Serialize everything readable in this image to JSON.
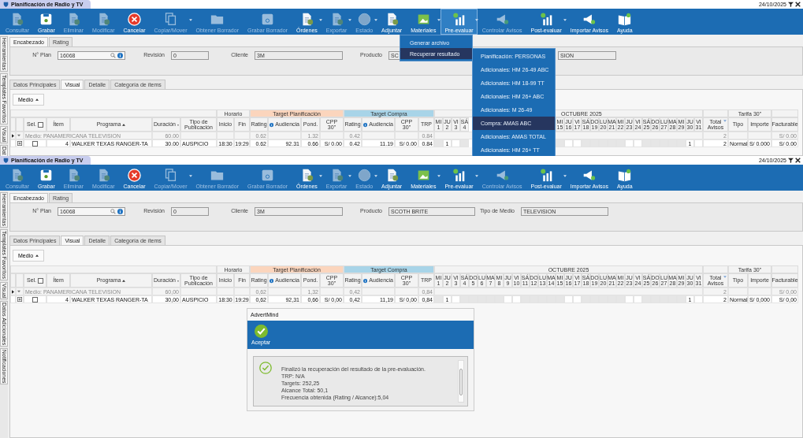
{
  "windows": [
    {
      "title": "Planificación de Radio y TV",
      "date": "24/10/2025",
      "toolbar": [
        {
          "label": "Consultar",
          "kind": "doc",
          "disabled": true,
          "dropdown": false,
          "open": false
        },
        {
          "label": "Grabar",
          "kind": "save",
          "disabled": false,
          "dropdown": false,
          "open": false
        },
        {
          "label": "Eliminar",
          "kind": "doc",
          "disabled": true,
          "dropdown": false,
          "open": false
        },
        {
          "label": "Modificar",
          "kind": "doc",
          "disabled": true,
          "dropdown": false,
          "open": false
        },
        {
          "label": "Cancelar",
          "kind": "cancel",
          "disabled": false,
          "dropdown": false,
          "open": false
        },
        {
          "label": "Copiar/Mover",
          "kind": "copy",
          "disabled": true,
          "dropdown": true,
          "open": false
        },
        {
          "label": "Obtener Borrador",
          "kind": "folder",
          "disabled": true,
          "dropdown": false,
          "open": false
        },
        {
          "label": "Grabar Borrador",
          "kind": "disk",
          "disabled": true,
          "dropdown": false,
          "open": false
        },
        {
          "label": "Órdenes",
          "kind": "doc",
          "disabled": false,
          "dropdown": true,
          "open": false
        },
        {
          "label": "Exportar",
          "kind": "doc",
          "disabled": true,
          "dropdown": true,
          "open": false
        },
        {
          "label": "Estado",
          "kind": "globe",
          "disabled": true,
          "dropdown": true,
          "open": false
        },
        {
          "label": "Adjuntar",
          "kind": "doc",
          "disabled": false,
          "dropdown": false,
          "open": false
        },
        {
          "label": "Materiales",
          "kind": "image",
          "disabled": false,
          "dropdown": true,
          "open": false
        },
        {
          "label": "Pre-evaluar",
          "kind": "chart",
          "disabled": false,
          "dropdown": true,
          "open": true
        },
        {
          "label": "Controlar Avisos",
          "kind": "megaphone",
          "disabled": true,
          "dropdown": false,
          "open": false
        },
        {
          "label": "Post-evaluar",
          "kind": "chart",
          "disabled": false,
          "dropdown": true,
          "open": false
        },
        {
          "label": "Importar Avisos",
          "kind": "megaphone",
          "disabled": false,
          "dropdown": false,
          "open": false
        },
        {
          "label": "Ayuda",
          "kind": "book",
          "disabled": false,
          "dropdown": false,
          "open": false
        }
      ],
      "side_tabs": [
        "Herramientas",
        "Templates Favoritos",
        "Visual",
        "Dat"
      ],
      "header_tabs": [
        {
          "label": "Encabezado",
          "selected": true
        },
        {
          "label": "Rating",
          "selected": false
        }
      ],
      "fields": [
        {
          "label": "N° Plan",
          "value": "16068",
          "kind": "search"
        },
        {
          "label": "Revisión",
          "value": "0",
          "kind": "text"
        },
        {
          "label": "Cliente",
          "value": "3M",
          "kind": "text"
        },
        {
          "label": "Producto",
          "value": "SC",
          "kind": "text"
        },
        {
          "value": "SION",
          "kind": "text"
        }
      ],
      "tabs": [
        {
          "label": "Datos Principales",
          "selected": false
        },
        {
          "label": "Visual",
          "selected": true
        },
        {
          "label": "Detalle",
          "selected": false
        },
        {
          "label": "Categoría de ítems",
          "selected": false
        }
      ],
      "group_by": "Medio",
      "grid": {
        "groups": [
          {
            "columns": [
              {
                "kind": "blank"
              },
              {
                "kind": "blank"
              },
              {
                "label": "Sel.",
                "kind": "check",
                "checked": false
              },
              {
                "label": "Ítem",
                "kind": "plain"
              },
              {
                "label": "Programa",
                "kind": "sort"
              },
              {
                "label": "Duración",
                "kind": "sort"
              },
              {
                "label": "Tipo de Publicación",
                "kind": "plain"
              }
            ]
          },
          {
            "label": "Horario",
            "columns": [
              {
                "label": "Inicio",
                "kind": "plain"
              },
              {
                "label": "Fin",
                "kind": "plain"
              }
            ]
          },
          {
            "label": "Target Planificación",
            "color": "#fbd5bd",
            "columns": [
              {
                "label": "Rating",
                "kind": "plain"
              },
              {
                "label": "Audiencia",
                "kind": "info"
              },
              {
                "label": "Pond.",
                "kind": "plain"
              },
              {
                "label": "CPP 30\"",
                "kind": "plain"
              }
            ]
          },
          {
            "label": "Target Compra",
            "color": "#a8d4e8",
            "columns": [
              {
                "label": "Rating",
                "kind": "plain"
              },
              {
                "label": "Audiencia",
                "kind": "info"
              },
              {
                "label": "CPP 30\"",
                "kind": "plain"
              },
              {
                "label": "TRP",
                "kind": "plain"
              }
            ]
          },
          {
            "label": "OCTUBRE 2025",
            "kind": "days"
          },
          {
            "columns": [
              {
                "label": "Total Avisos",
                "kind": "filter"
              }
            ]
          },
          {
            "label": "Tarifa 30\"",
            "columns": [
              {
                "label": "Tipo",
                "kind": "plain"
              },
              {
                "label": "Importe",
                "kind": "plain"
              }
            ]
          },
          {
            "columns": [
              {
                "label": "Facturable",
                "kind": "plain"
              }
            ]
          }
        ],
        "day_segments": [
          [
            {
              "weekday": "MI",
              "day": "1"
            },
            {
              "weekday": "JU",
              "day": "2"
            },
            {
              "weekday": "VI",
              "day": "3"
            },
            {
              "weekday": "SÁ",
              "day": "4"
            }
          ],
          [
            {
              "weekday": "MI",
              "day": "15"
            },
            {
              "weekday": "JU",
              "day": "16"
            },
            {
              "weekday": "VI",
              "day": "17"
            },
            {
              "weekday": "SÁ",
              "day": "18"
            },
            {
              "weekday": "DO",
              "day": "19"
            },
            {
              "weekday": "LU",
              "day": "20"
            },
            {
              "weekday": "MA",
              "day": "21"
            },
            {
              "weekday": "MI",
              "day": "22"
            },
            {
              "weekday": "JU",
              "day": "23"
            },
            {
              "weekday": "VI",
              "day": "24"
            },
            {
              "weekday": "SÁ",
              "day": "25"
            },
            {
              "weekday": "DO",
              "day": "26"
            },
            {
              "weekday": "LU",
              "day": "27"
            },
            {
              "weekday": "MA",
              "day": "28"
            },
            {
              "weekday": "MI",
              "day": "29"
            },
            {
              "weekday": "JU",
              "day": "30"
            },
            {
              "weekday": "VI",
              "day": "31"
            }
          ]
        ],
        "rows": [
          {
            "kind": "group",
            "expanded": true,
            "label": "Medio: PANAMERICANA TELEVISION",
            "duracion": "60.00",
            "rating_plan": "0.62",
            "pond": "1.32",
            "rating_compra": "0.42",
            "trp": "0.84",
            "total_avisos": "2",
            "facturable": "S/ 0.00"
          },
          {
            "kind": "item",
            "expanded": false,
            "checked": false,
            "item": "4",
            "programa": "WALKER TEXAS RANGER-TA",
            "duracion": "30.00",
            "tipo_publicacion": "AUSPICIO",
            "inicio": "18:30",
            "fin": "19:29",
            "rating_plan": "0.62",
            "audiencia_plan": "92.31",
            "pond": "0.66",
            "cpp_plan": "S/ 0.00",
            "rating_compra": "0.42",
            "audiencia_compra": "11.19",
            "cpp_compra": "S/ 0.00",
            "trp": "0.84",
            "total_avisos": "2",
            "tipo": "Normal",
            "importe": "S/ 0.000",
            "facturable": "S/ 0.00",
            "day_segments": [
              [
                {
                  "available": false
                },
                {
                  "available": true,
                  "spots": "1"
                },
                {
                  "available": true
                },
                {
                  "available": false
                }
              ],
              [
                {
                  "available": false
                },
                {
                  "available": true
                },
                {
                  "available": true
                },
                {
                  "available": false
                },
                {
                  "available": false
                },
                {
                  "available": false
                },
                {
                  "available": false
                },
                {
                  "available": false
                },
                {
                  "available": true
                },
                {
                  "available": true
                },
                {
                  "available": false
                },
                {
                  "available": false
                },
                {
                  "available": false
                },
                {
                  "available": false
                },
                {
                  "available": false
                },
                {
                  "available": true,
                  "spots": "1"
                },
                {
                  "available": true
                }
              ]
            ]
          }
        ]
      },
      "menu": {
        "items": [
          {
            "label": "Generar archivo",
            "selected": false
          },
          {
            "label": "Recuperar resultado",
            "selected": true
          }
        ],
        "submenu": [
          {
            "label": "Planificación: PERSONAS",
            "selected": false
          },
          {
            "label": "Adicionales: HM 26-49 ABC",
            "selected": false
          },
          {
            "label": "Adicionales: HM 18-99 TT",
            "selected": false
          },
          {
            "label": "Adicionales: HM 26+ ABC",
            "selected": false
          },
          {
            "label": "Adicionales: M 26-49",
            "selected": false
          },
          {
            "label": "Compra: AMAS ABC",
            "selected": true
          },
          {
            "label": "Adicionales: AMAS TOTAL",
            "selected": false
          },
          {
            "label": "Adicionales: HM 26+ TT",
            "selected": false
          }
        ]
      }
    },
    {
      "title": "Planificación de Radio y TV",
      "date": "24/10/2025",
      "toolbar": [
        {
          "label": "Consultar",
          "kind": "doc",
          "disabled": true,
          "dropdown": false,
          "open": false
        },
        {
          "label": "Grabar",
          "kind": "save",
          "disabled": false,
          "dropdown": false,
          "open": false
        },
        {
          "label": "Eliminar",
          "kind": "doc",
          "disabled": true,
          "dropdown": false,
          "open": false
        },
        {
          "label": "Modificar",
          "kind": "doc",
          "disabled": true,
          "dropdown": false,
          "open": false
        },
        {
          "label": "Cancelar",
          "kind": "cancel",
          "disabled": false,
          "dropdown": false,
          "open": false
        },
        {
          "label": "Copiar/Mover",
          "kind": "copy",
          "disabled": true,
          "dropdown": true,
          "open": false
        },
        {
          "label": "Obtener Borrador",
          "kind": "folder",
          "disabled": true,
          "dropdown": false,
          "open": false
        },
        {
          "label": "Grabar Borrador",
          "kind": "disk",
          "disabled": true,
          "dropdown": false,
          "open": false
        },
        {
          "label": "Órdenes",
          "kind": "doc",
          "disabled": false,
          "dropdown": true,
          "open": false
        },
        {
          "label": "Exportar",
          "kind": "doc",
          "disabled": true,
          "dropdown": true,
          "open": false
        },
        {
          "label": "Estado",
          "kind": "globe",
          "disabled": true,
          "dropdown": true,
          "open": false
        },
        {
          "label": "Adjuntar",
          "kind": "doc",
          "disabled": false,
          "dropdown": false,
          "open": false
        },
        {
          "label": "Materiales",
          "kind": "image",
          "disabled": false,
          "dropdown": true,
          "open": false
        },
        {
          "label": "Pre-evaluar",
          "kind": "chart",
          "disabled": false,
          "dropdown": true,
          "open": false
        },
        {
          "label": "Controlar Avisos",
          "kind": "megaphone",
          "disabled": true,
          "dropdown": false,
          "open": false
        },
        {
          "label": "Post-evaluar",
          "kind": "chart",
          "disabled": false,
          "dropdown": true,
          "open": false
        },
        {
          "label": "Importar Avisos",
          "kind": "megaphone",
          "disabled": false,
          "dropdown": false,
          "open": false
        },
        {
          "label": "Ayuda",
          "kind": "book",
          "disabled": false,
          "dropdown": false,
          "open": false
        }
      ],
      "side_tabs": [
        "Herramientas",
        "Templates Favoritos",
        "Visual",
        "Datos Adicionales",
        "Notificaciones"
      ],
      "header_tabs": [
        {
          "label": "Encabezado",
          "selected": true
        },
        {
          "label": "Rating",
          "selected": false
        }
      ],
      "fields": [
        {
          "label": "N° Plan",
          "value": "16068",
          "kind": "search"
        },
        {
          "label": "Revisión",
          "value": "0",
          "kind": "text"
        },
        {
          "label": "Cliente",
          "value": "3M",
          "kind": "text"
        },
        {
          "label": "Producto",
          "value": "SCOTH BRITE",
          "kind": "text"
        },
        {
          "label": "Tipo de Medio",
          "value": "TELEVISION",
          "kind": "text"
        }
      ],
      "tabs": [
        {
          "label": "Datos Principales",
          "selected": false
        },
        {
          "label": "Visual",
          "selected": true
        },
        {
          "label": "Detalle",
          "selected": false
        },
        {
          "label": "Categoría de ítems",
          "selected": false
        }
      ],
      "group_by": "Medio",
      "grid": {
        "groups": [
          {
            "columns": [
              {
                "kind": "blank"
              },
              {
                "kind": "blank"
              },
              {
                "label": "Sel.",
                "kind": "check",
                "checked": false
              },
              {
                "label": "Ítem",
                "kind": "plain"
              },
              {
                "label": "Programa",
                "kind": "sort"
              },
              {
                "label": "Duración",
                "kind": "sort"
              },
              {
                "label": "Tipo de Publicación",
                "kind": "plain"
              }
            ]
          },
          {
            "label": "Horario",
            "columns": [
              {
                "label": "Inicio",
                "kind": "plain"
              },
              {
                "label": "Fin",
                "kind": "plain"
              }
            ]
          },
          {
            "label": "Target Planificación",
            "color": "#fbd5bd",
            "columns": [
              {
                "label": "Rating",
                "kind": "plain"
              },
              {
                "label": "Audiencia",
                "kind": "info"
              },
              {
                "label": "Pond.",
                "kind": "plain"
              },
              {
                "label": "CPP 30\"",
                "kind": "plain"
              }
            ]
          },
          {
            "label": "Target Compra",
            "color": "#a8d4e8",
            "columns": [
              {
                "label": "Rating",
                "kind": "plain"
              },
              {
                "label": "Audiencia",
                "kind": "info"
              },
              {
                "label": "CPP 30\"",
                "kind": "plain"
              },
              {
                "label": "TRP",
                "kind": "plain"
              }
            ]
          },
          {
            "label": "OCTUBRE 2025",
            "kind": "days"
          },
          {
            "columns": [
              {
                "label": "Total Avisos",
                "kind": "filter"
              }
            ]
          },
          {
            "label": "Tarifa 30\"",
            "columns": [
              {
                "label": "Tipo",
                "kind": "plain"
              },
              {
                "label": "Importe",
                "kind": "plain"
              }
            ]
          },
          {
            "columns": [
              {
                "label": "Facturable",
                "kind": "plain"
              }
            ]
          }
        ],
        "day_segments": [
          [
            {
              "weekday": "MI",
              "day": "1"
            },
            {
              "weekday": "JU",
              "day": "2"
            },
            {
              "weekday": "VI",
              "day": "3"
            },
            {
              "weekday": "SÁ",
              "day": "4"
            },
            {
              "weekday": "DO",
              "day": "5"
            },
            {
              "weekday": "LU",
              "day": "6"
            },
            {
              "weekday": "MA",
              "day": "7"
            },
            {
              "weekday": "MI",
              "day": "8"
            },
            {
              "weekday": "JU",
              "day": "9"
            },
            {
              "weekday": "VI",
              "day": "10"
            },
            {
              "weekday": "SÁ",
              "day": "11"
            },
            {
              "weekday": "DO",
              "day": "12"
            },
            {
              "weekday": "LU",
              "day": "13"
            },
            {
              "weekday": "MA",
              "day": "14"
            },
            {
              "weekday": "MI",
              "day": "15"
            },
            {
              "weekday": "JU",
              "day": "16"
            },
            {
              "weekday": "VI",
              "day": "17"
            },
            {
              "weekday": "SÁ",
              "day": "18"
            },
            {
              "weekday": "DO",
              "day": "19"
            },
            {
              "weekday": "LU",
              "day": "20"
            },
            {
              "weekday": "MA",
              "day": "21"
            },
            {
              "weekday": "MI",
              "day": "22"
            },
            {
              "weekday": "JU",
              "day": "23"
            },
            {
              "weekday": "VI",
              "day": "24"
            },
            {
              "weekday": "SÁ",
              "day": "25"
            },
            {
              "weekday": "DO",
              "day": "26"
            },
            {
              "weekday": "LU",
              "day": "27"
            },
            {
              "weekday": "MA",
              "day": "28"
            },
            {
              "weekday": "MI",
              "day": "29"
            },
            {
              "weekday": "JU",
              "day": "30"
            },
            {
              "weekday": "VI",
              "day": "31"
            }
          ]
        ],
        "rows": [
          {
            "kind": "group",
            "expanded": true,
            "label": "Medio: PANAMERICANA TELEVISION",
            "duracion": "60,00",
            "rating_plan": "0,62",
            "pond": "1,32",
            "rating_compra": "0,42",
            "trp": "0,84",
            "total_avisos": "2",
            "facturable": "S/ 0,00"
          },
          {
            "kind": "item",
            "expanded": false,
            "checked": false,
            "item": "4",
            "programa": "WALKER TEXAS RANGER-TA",
            "duracion": "30,00",
            "tipo_publicacion": "AUSPICIO",
            "inicio": "18:30",
            "fin": "19:29",
            "rating_plan": "0,62",
            "audiencia_plan": "92,31",
            "pond": "0,66",
            "cpp_plan": "S/ 0,00",
            "rating_compra": "0,42",
            "audiencia_compra": "11,19",
            "cpp_compra": "S/ 0,00",
            "trp": "0,84",
            "total_avisos": "2",
            "tipo": "Normal",
            "importe": "S/ 0,000",
            "facturable": "S/ 0,00",
            "day_segments": [
              [
                {
                  "available": false
                },
                {
                  "available": true,
                  "spots": "1"
                },
                {
                  "available": true
                },
                {
                  "available": false
                },
                {
                  "available": false
                },
                {
                  "available": false
                },
                {
                  "available": false
                },
                {
                  "available": false
                },
                {
                  "available": true
                },
                {
                  "available": true
                },
                {
                  "available": false
                },
                {
                  "available": false
                },
                {
                  "available": false
                },
                {
                  "available": false
                },
                {
                  "available": false
                },
                {
                  "available": true
                },
                {
                  "available": true
                },
                {
                  "available": false
                },
                {
                  "available": false
                },
                {
                  "available": false
                },
                {
                  "available": false
                },
                {
                  "available": false
                },
                {
                  "available": true
                },
                {
                  "available": true
                },
                {
                  "available": false
                },
                {
                  "available": false
                },
                {
                  "available": false
                },
                {
                  "available": false
                },
                {
                  "available": false
                },
                {
                  "available": true,
                  "spots": "1"
                },
                {
                  "available": true
                }
              ]
            ]
          }
        ]
      },
      "dialog": {
        "title": "AdvertMind",
        "button": "Aceptar",
        "lines": [
          "Finalizó la recuperación del resultado de la pre-evaluación.",
          "TRP: N/A",
          "Targets: 252,25",
          "Alcance Total: 50,1",
          "Frecuencia obtenida (Rating / Alcance):5,04"
        ]
      }
    }
  ]
}
